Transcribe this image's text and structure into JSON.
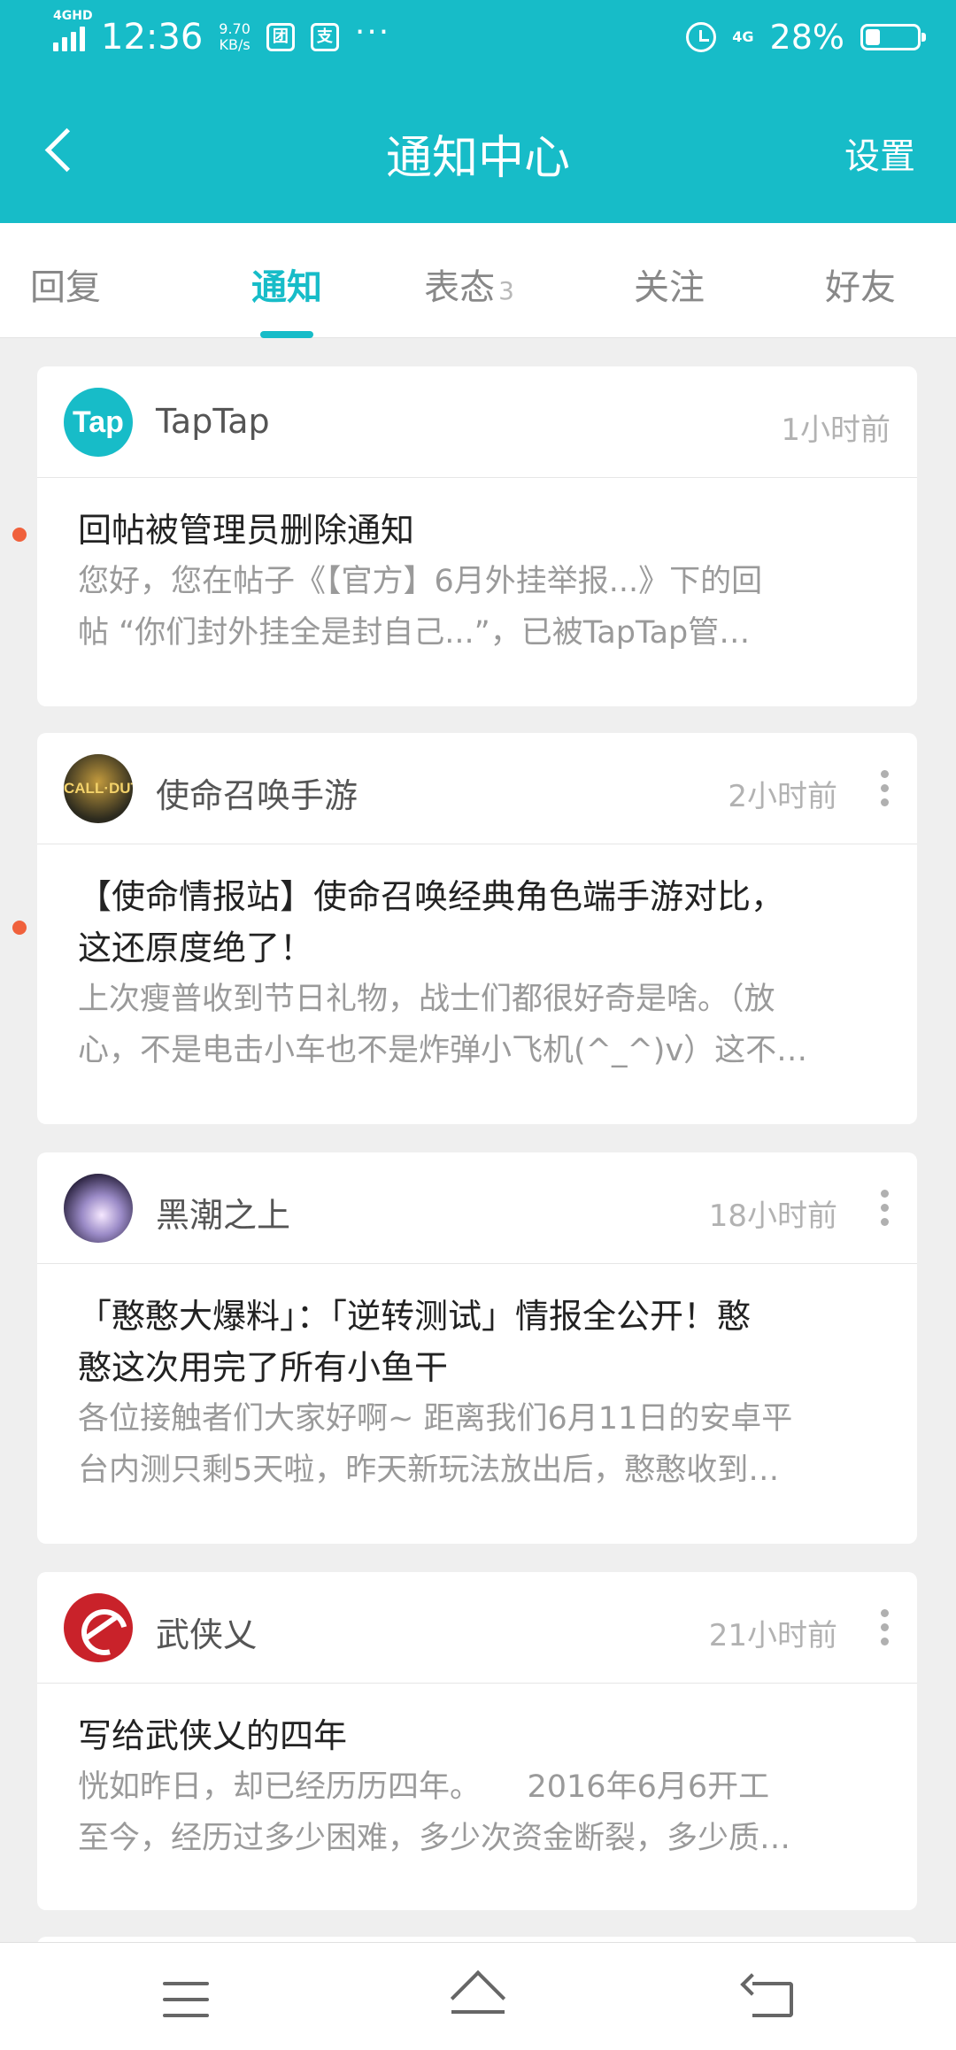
{
  "status_bar": {
    "network": "4GHD",
    "time": "12:36",
    "speed_value": "9.70",
    "speed_unit": "KB/s",
    "app_icon_1": "团",
    "app_icon_2": "支",
    "more": "···",
    "network_right": "4G",
    "battery": "28%",
    "battery_level": 0.28
  },
  "header": {
    "title": "通知中心",
    "settings_label": "设置"
  },
  "tabs": [
    {
      "label": "回复"
    },
    {
      "label": "通知"
    },
    {
      "label": "表态",
      "badge": "3"
    },
    {
      "label": "关注"
    },
    {
      "label": "好友"
    }
  ],
  "notifications": [
    {
      "source": "TapTap",
      "avatar_text": "Tap",
      "time": "1小时前",
      "title": "回帖被管理员删除通知",
      "excerpt_line1": "您好，您在帖子《【官方】6月外挂举报...》下的回",
      "excerpt_line2": "帖 “你们封外挂全是封自己...”，已被TapTap管…"
    },
    {
      "source": "使命召唤手游",
      "avatar_text": "CALL·DUTY",
      "time": "2小时前",
      "title_line1": "【使命情报站】使命召唤经典角色端手游对比，",
      "title_line2": "这还原度绝了！",
      "excerpt_line1": "上次瘦普收到节日礼物，战士们都很好奇是啥。（放",
      "excerpt_line2": "心，不是电击小车也不是炸弹小飞机(^_^)v）这不…"
    },
    {
      "source": "黑潮之上",
      "time": "18小时前",
      "title_line1": "「憨憨大爆料」：「逆转测试」情报全公开！憨",
      "title_line2": "憨这次用完了所有小鱼干",
      "excerpt_line1": "各位接触者们大家好啊~ 距离我们6月11日的安卓平",
      "excerpt_line2": "台内测只剩5天啦，昨天新玩法放出后，憨憨收到…"
    },
    {
      "source": "武侠乂",
      "time": "21小时前",
      "title": "写给武侠乂的四年",
      "excerpt_line1": "恍如昨日，却已经历历四年。　　2016年6月6开工",
      "excerpt_line2": "至今，经历过多少困难，多少次资金断裂，多少质…"
    }
  ]
}
